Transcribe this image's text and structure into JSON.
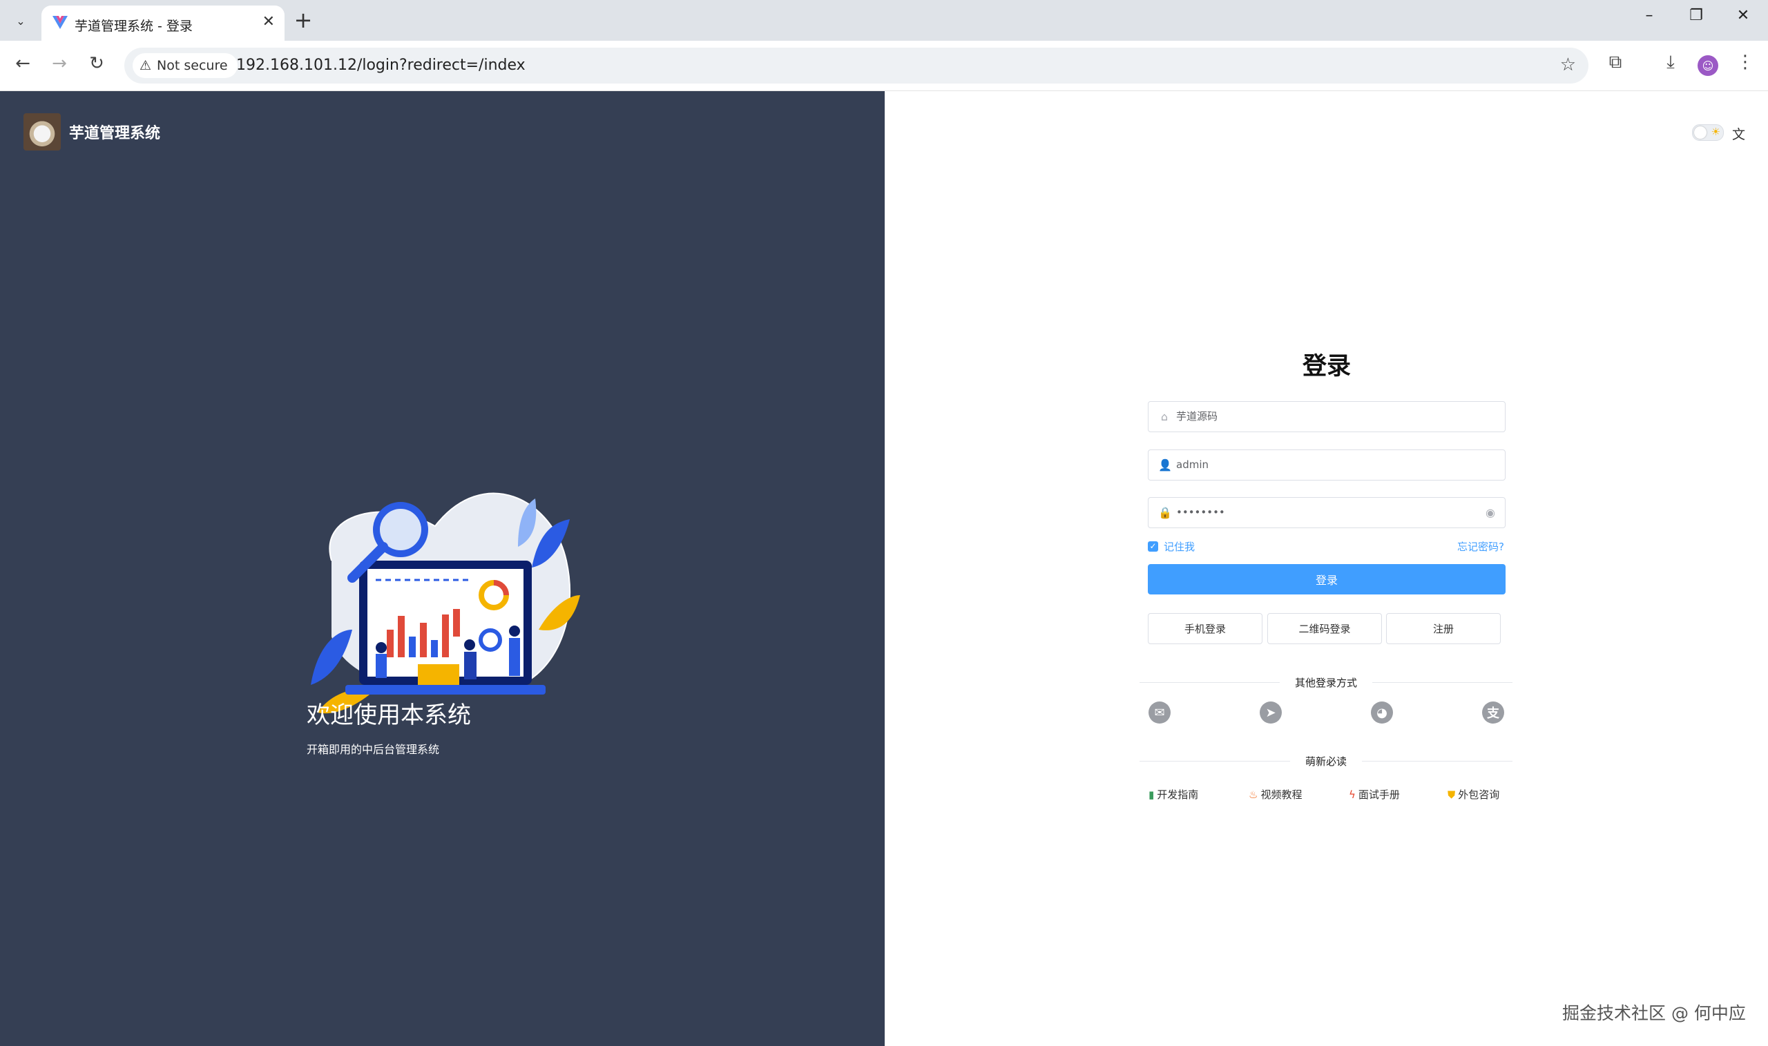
{
  "browser": {
    "tab_title": "芋道管理系统 - 登录",
    "security_label": "Not secure",
    "url": "192.168.101.12/login?redirect=/index"
  },
  "brand": {
    "name": "芋道管理系统"
  },
  "welcome": {
    "title": "欢迎使用本系统",
    "subtitle": "开箱即用的中后台管理系统"
  },
  "login": {
    "title": "登录",
    "tenant_value": "芋道源码",
    "username_value": "admin",
    "password_value": "••••••••",
    "remember_label": "记住我",
    "remember_checked": true,
    "forgot_label": "忘记密码?",
    "submit_label": "登录",
    "alt_buttons": [
      "手机登录",
      "二维码登录",
      "注册"
    ],
    "other_methods_label": "其他登录方式",
    "social_icons": [
      "wechat-icon",
      "dingtalk-icon",
      "github-icon",
      "alipay-icon"
    ],
    "guides_label": "萌新必读",
    "guides": [
      {
        "label": "开发指南",
        "icon": "book-icon"
      },
      {
        "label": "视频教程",
        "icon": "fire-icon"
      },
      {
        "label": "面试手册",
        "icon": "lightning-icon"
      },
      {
        "label": "外包咨询",
        "icon": "shield-icon"
      }
    ]
  },
  "watermark": "掘金技术社区 @ 何中应",
  "colors": {
    "accent": "#409eff",
    "left_panel": "#353f54"
  }
}
